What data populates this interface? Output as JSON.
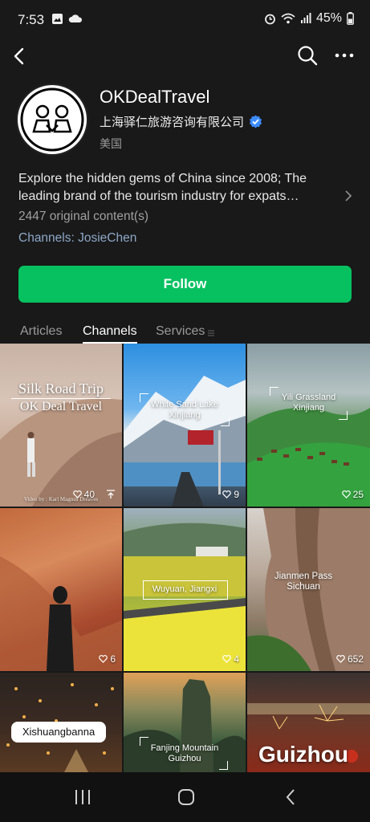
{
  "status_bar": {
    "time": "7:53",
    "battery": "45%",
    "icons": [
      "gallery-icon",
      "cloud-icon",
      "alarm-icon",
      "wifi-icon",
      "signal-icon",
      "battery-icon"
    ]
  },
  "nav": {
    "icons": [
      "back-arrow-icon",
      "search-icon",
      "more-icon"
    ]
  },
  "profile": {
    "name": "OKDealTravel",
    "company": "上海驿仁旅游咨询有限公司",
    "country": "美国",
    "bio_line1": "Explore the hidden gems of China since 2008; The",
    "bio_line2": "leading brand of the tourism industry for expats…",
    "content_count": "2447 original content(s)",
    "channels_link": "Channels: JosieChen",
    "follow_label": "Follow",
    "verified_color": "#3d8cff"
  },
  "tabs": [
    {
      "label": "Articles"
    },
    {
      "label": "Channels"
    },
    {
      "label": "Services"
    }
  ],
  "tiles": [
    {
      "caption1": "Silk Road Trip",
      "caption2": "OK Deal Travel",
      "caption3": "Video by : Karl Magnus Dreaves",
      "likes": "40"
    },
    {
      "caption": "White Sand Lake Xinjiang",
      "likes": "9"
    },
    {
      "caption": "Yili Grassland Xinjiang",
      "likes": "25"
    },
    {
      "caption": "",
      "likes": "6"
    },
    {
      "caption": "Wuyuan, Jiangxi",
      "likes": "4"
    },
    {
      "caption": "Jianmen Pass Sichuan",
      "likes": "652"
    },
    {
      "caption": "Xishuangbanna",
      "likes": ""
    },
    {
      "caption": "Fanjing Mountain Guizhou",
      "likes": ""
    },
    {
      "caption": "Guizhou",
      "likes": ""
    }
  ],
  "colors": {
    "background": "#191919",
    "follow": "#07c160",
    "link": "#8da8c8"
  }
}
